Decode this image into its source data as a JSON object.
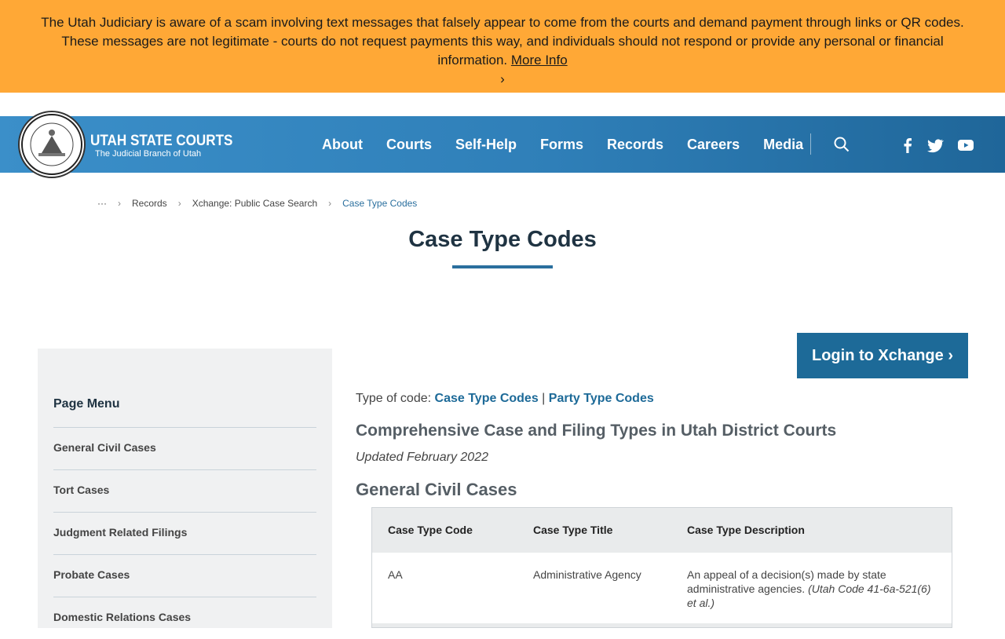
{
  "alert": {
    "text": "The Utah Judiciary is aware of a scam involving text messages that falsely appear to come from the courts and demand payment through links or QR codes. These messages are not legitimate - courts do not request payments this way, and individuals should not respond or provide any personal or financial information.",
    "link": "More Info",
    "chevron": "›"
  },
  "header": {
    "brand_title": "UTAH STATE COURTS",
    "brand_subtitle": "The Judicial Branch of Utah",
    "nav": [
      "About",
      "Courts",
      "Self-Help",
      "Forms",
      "Records",
      "Careers",
      "Media"
    ]
  },
  "breadcrumb": {
    "ellipsis": "···",
    "items": [
      "Records",
      "Xchange: Public Case Search",
      "Case Type Codes"
    ],
    "separator": "›"
  },
  "page_title": "Case Type Codes",
  "sidebar": {
    "heading": "Page Menu",
    "items": [
      "General Civil Cases",
      "Tort Cases",
      "Judgment Related Filings",
      "Probate Cases",
      "Domestic Relations Cases"
    ]
  },
  "login_button": "Login to Xchange ›",
  "content": {
    "type_label": "Type of code:",
    "type_links": [
      "Case Type Codes",
      "Party Type Codes"
    ],
    "type_separator": "|",
    "heading": "Comprehensive Case and Filing Types in Utah District Courts",
    "updated": "Updated February 2022",
    "section": "General Civil Cases",
    "table": {
      "headers": [
        "Case Type Code",
        "Case Type Title",
        "Case Type Description"
      ],
      "rows": [
        {
          "code": "AA",
          "title": "Administrative Agency",
          "description": "An appeal of a decision(s) made by state administrative agencies.",
          "citation": "(Utah Code 41-6a-521(6) et al.)"
        }
      ]
    }
  },
  "colors": {
    "alert_bg": "#ffa836",
    "header_blue": "#2f7fb8",
    "link_blue": "#1d6a98",
    "sidebar_bg": "#f0f1f2"
  }
}
